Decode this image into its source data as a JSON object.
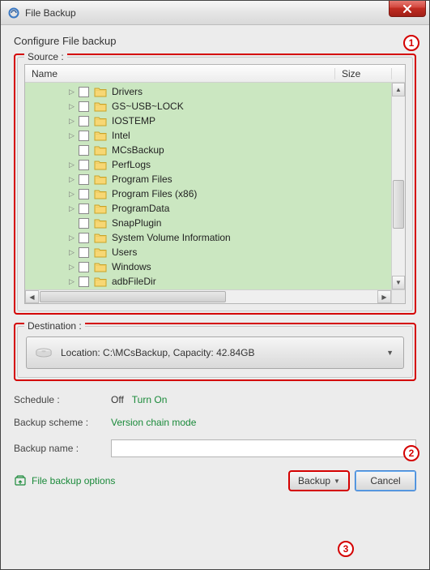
{
  "window": {
    "title": "File Backup"
  },
  "header": {
    "configure": "Configure File backup"
  },
  "callouts": {
    "one": "1",
    "two": "2",
    "three": "3"
  },
  "source": {
    "legend": "Source :",
    "columns": {
      "name": "Name",
      "size": "Size"
    },
    "items": [
      {
        "label": "Drivers",
        "expandable": true
      },
      {
        "label": "GS~USB~LOCK",
        "expandable": true
      },
      {
        "label": "IOSTEMP",
        "expandable": true
      },
      {
        "label": "Intel",
        "expandable": true
      },
      {
        "label": "MCsBackup",
        "expandable": false
      },
      {
        "label": "PerfLogs",
        "expandable": true
      },
      {
        "label": "Program Files",
        "expandable": true
      },
      {
        "label": "Program Files (x86)",
        "expandable": true
      },
      {
        "label": "ProgramData",
        "expandable": true
      },
      {
        "label": "SnapPlugin",
        "expandable": false
      },
      {
        "label": "System Volume Information",
        "expandable": true
      },
      {
        "label": "Users",
        "expandable": true
      },
      {
        "label": "Windows",
        "expandable": true
      },
      {
        "label": "adbFileDir",
        "expandable": true
      }
    ]
  },
  "destination": {
    "legend": "Destination :",
    "location_text": "Location: C:\\MCsBackup, Capacity: 42.84GB"
  },
  "schedule": {
    "label": "Schedule :",
    "value": "Off",
    "link": "Turn On"
  },
  "scheme": {
    "label": "Backup scheme :",
    "value": "Version chain mode"
  },
  "name": {
    "label": "Backup name :",
    "value": ""
  },
  "options_link": "File backup options",
  "buttons": {
    "backup": "Backup",
    "cancel": "Cancel"
  }
}
